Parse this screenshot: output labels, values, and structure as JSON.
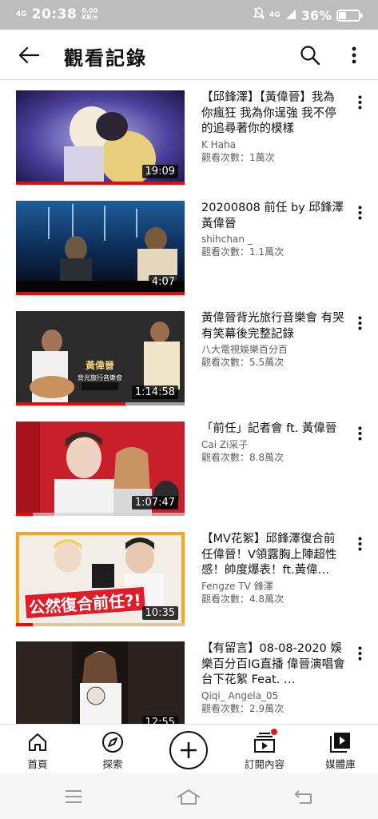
{
  "status_bar": {
    "signal": "4G",
    "time": "20:38",
    "net_speed_value": "0.00",
    "net_speed_unit": "KB/s",
    "network": "4G",
    "battery_text": "36%",
    "battery_level": 0.36
  },
  "header": {
    "title": "觀看記錄",
    "back_icon": "arrow-left-icon",
    "search_icon": "search-icon",
    "more_icon": "more-vert-icon"
  },
  "videos": [
    {
      "title": "【邱鋒澤】【黃偉晉】我為你瘋狂 我為你逞強 我不停的追尋著你的模樣",
      "channel": "K Haha",
      "views": "觀看次數：1萬次",
      "duration": "19:09",
      "watched": 1.0
    },
    {
      "title": "20200808 前任 by 邱鋒澤 黃偉晉",
      "channel": "shihchan _",
      "views": "觀看次數：1.1萬次",
      "duration": "4:07",
      "watched": 1.0
    },
    {
      "title": "黃偉晉背光旅行音樂會 有哭有笑幕後完整記錄",
      "channel": "八大電視娛樂百分百",
      "views": "觀看次數：5.5萬次",
      "duration": "1:14:58",
      "watched": 0.65
    },
    {
      "title": "「前任」記者會 ft. 黃偉晉",
      "channel": "Cai Zi采子",
      "views": "觀看次數：8.8萬次",
      "duration": "1:07:47",
      "watched": 0.1
    },
    {
      "title": "【MV花絮】邱鋒澤復合前任偉晉！V領露胸上陣超性感！帥度爆表！ft.黃偉…",
      "channel": "Fengze TV 鋒澤",
      "views": "觀看次數：4.8萬次",
      "duration": "10:35",
      "watched": 0.1,
      "thumb_text": "公然復合前任?!"
    },
    {
      "title": "【有留言】08-08-2020 娛樂百分百IG直播 偉晉演唱會台下花絮 Feat. …",
      "channel": "Qiqi_ Angela_05",
      "views": "觀看次數：2.9萬次",
      "duration": "12:55",
      "watched": 0.0
    }
  ],
  "bottom_nav": [
    {
      "label": "首頁",
      "icon": "home-icon"
    },
    {
      "label": "探索",
      "icon": "compass-icon"
    },
    {
      "label": "",
      "icon": "add-circle-icon"
    },
    {
      "label": "訂閱內容",
      "icon": "subscriptions-icon"
    },
    {
      "label": "媒體庫",
      "icon": "library-icon"
    }
  ],
  "colors": {
    "accent": "#ff0000",
    "text_primary": "#0f0f0f",
    "text_secondary": "#606060",
    "status_bar": "#bdbdbd"
  }
}
